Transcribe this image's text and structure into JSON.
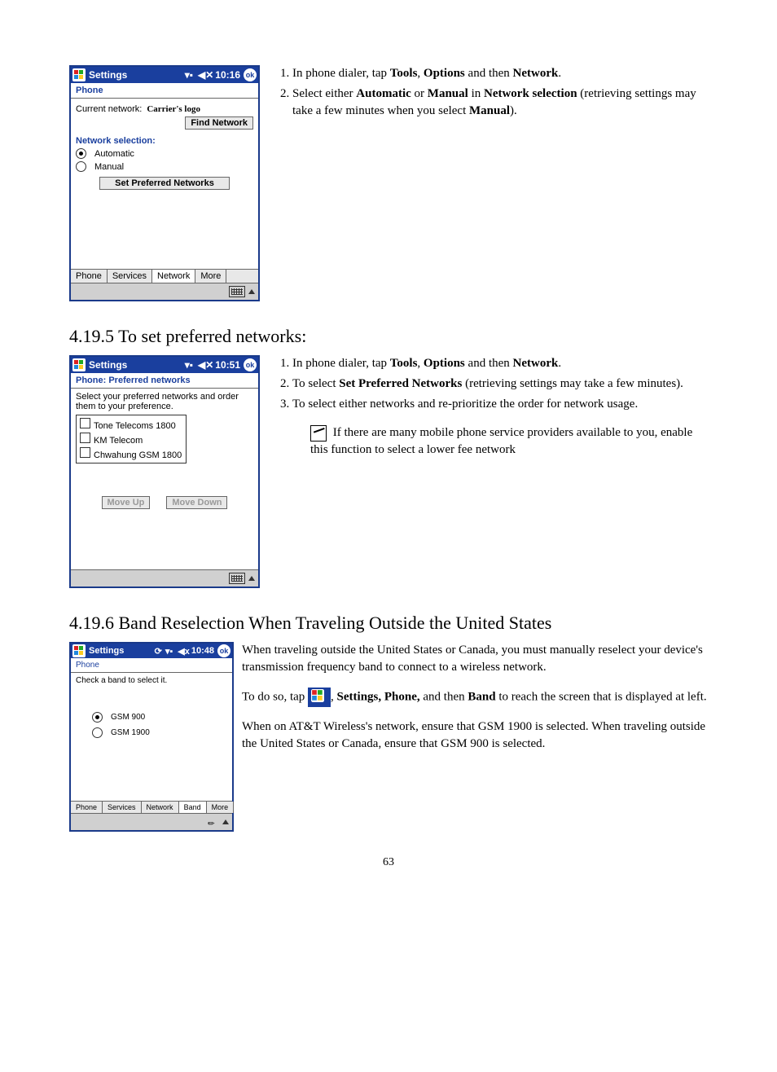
{
  "section1": {
    "instructions": {
      "li1_pre": "In phone dialer, tap ",
      "li1_tools": "Tools",
      "li1_sep1": ", ",
      "li1_options": "Options",
      "li1_sep2": " and then ",
      "li1_network": "Network",
      "li1_end": ".",
      "li2_pre": "Select either ",
      "li2_auto": "Automatic",
      "li2_or": " or ",
      "li2_manual": "Manual",
      "li2_in": " in ",
      "li2_netsel": "Network selection ",
      "li2_retr": "(retrieving settings may take a few minutes when you select ",
      "li2_manual2": "Manual",
      "li2_end": ")."
    },
    "screen": {
      "title": "Settings",
      "time": "10:16",
      "ok": "ok",
      "header": "Phone",
      "current_net_label": "Current network:",
      "carrier": "Carrier's logo",
      "find_btn": "Find Network",
      "netsel_label": "Network selection:",
      "radio1": "Automatic",
      "radio2": "Manual",
      "set_pref_btn": "Set Preferred Networks",
      "tabs": [
        "Phone",
        "Services",
        "Network",
        "More"
      ]
    }
  },
  "heading2": "4.19.5 To set preferred networks:",
  "section2": {
    "instructions": {
      "li1_pre": "In phone dialer, tap ",
      "li1_tools": "Tools",
      "li1_sep1": ", ",
      "li1_options": "Options",
      "li1_sep2": " and then ",
      "li1_network": "Network",
      "li1_end": ".",
      "li2_pre": "To select ",
      "li2_spn": "Set Preferred Networks ",
      "li2_retr": "(retrieving settings may take a few minutes).",
      "li3": "To select either networks and re-prioritize the order for network usage."
    },
    "note": "If there are many mobile phone service providers available to you, enable this function to select a lower fee network",
    "screen": {
      "title": "Settings",
      "time": "10:51",
      "ok": "ok",
      "header": "Phone: Preferred networks",
      "instr": "Select your preferred networks and order them to your preference.",
      "networks": [
        "Tone Telecoms 1800",
        "KM Telecom",
        "Chwahung GSM 1800"
      ],
      "move_up": "Move Up",
      "move_down": "Move Down"
    }
  },
  "heading3": "4.19.6  Band Reselection When Traveling Outside the United States",
  "section3": {
    "para1": "When traveling outside the United States or Canada, you must manually reselect your device's transmission frequency band to connect to a wireless network.",
    "para2_pre": "To do so, tap ",
    "para2_mid": ", ",
    "para2_settings": "Settings, Phone, ",
    "para2_andthen": "and then ",
    "para2_band": "Band ",
    "para2_end": "to reach the screen that is displayed at left.",
    "para3": "When on AT&T Wireless's network, ensure that GSM 1900 is selected.  When traveling outside the United States or Canada, ensure that GSM 900 is selected.",
    "screen": {
      "title": "Settings",
      "time": "10:48",
      "ok": "ok",
      "header": "Phone",
      "instr": "Check a band to select it.",
      "band1": "GSM 900",
      "band2": "GSM 1900",
      "tabs": [
        "Phone",
        "Services",
        "Network",
        "Band",
        "More"
      ]
    }
  },
  "page_num": "63"
}
